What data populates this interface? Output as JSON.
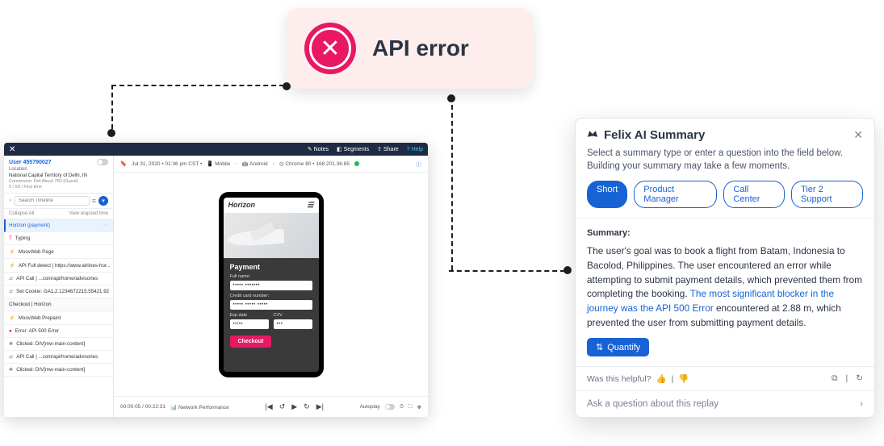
{
  "api_badge": {
    "label": "API error"
  },
  "replay": {
    "topbar": {
      "notes": "Notes",
      "segments": "Segments",
      "share": "Share",
      "help": "Help"
    },
    "user": {
      "id_label": "User 455790027",
      "location_label": "Location",
      "location": "National Capital Territory of Delhi, IN",
      "conv_label": "Conversion: Def About 750 (Guest)",
      "conv_value": "0 / 50 / First time"
    },
    "search": {
      "placeholder": "Search Timeline"
    },
    "collapse": {
      "left": "Collapse All",
      "right": "View elapsed time"
    },
    "timeline_items": [
      {
        "label": "Horizon (payment)",
        "selected": true
      },
      {
        "label": "Typing"
      },
      {
        "label": "MoovWeb Page"
      },
      {
        "label": "API Full detect | https://www.airlines-hor..."
      },
      {
        "label": "API Call | ...com/api/home/advisories"
      },
      {
        "label": "Set Cookie: GA1.2.1234672215.55421.92"
      },
      {
        "label": "Checkout | Horizon",
        "header": true
      },
      {
        "label": "MoovWeb Prepaint"
      },
      {
        "label": "Error: API 500 Error"
      },
      {
        "label": "Clicked: DIV[mw-main-content]"
      },
      {
        "label": "API Call | ...com/api/home/advisories"
      },
      {
        "label": "Clicked: DIV[mw-main-content]"
      }
    ],
    "meta": {
      "date": "Jul 31, 2020 • 01:36 pm CST •",
      "device": "Mobile",
      "os": "Android",
      "browser": "Chrome 80 • 168.201.36.85"
    },
    "phone": {
      "brand": "Horizon",
      "payment_title": "Payment",
      "full_name_label": "Full name:",
      "full_name_value": "•••••  •••••••",
      "card_label": "Credit card number:",
      "card_value": "•••••  •••••  •••••",
      "exp_label": "Exp date",
      "exp_value": "••/••",
      "cvv_label": "CVV",
      "cvv_value": "•••",
      "checkout": "Checkout"
    },
    "player": {
      "time": "00:00:05 / 00:22:31",
      "network": "Network Performance",
      "autoplay": "Autoplay"
    }
  },
  "felix": {
    "title": "Felix AI Summary",
    "instructions": "Select a summary type or enter a question into the field below. Building your summary may take a few moments.",
    "chips": [
      "Short",
      "Product Manager",
      "Call Center",
      "Tier 2 Support"
    ],
    "summary_label": "Summary:",
    "summary_pre": "The user's goal was to book a flight from Batam, Indonesia to Bacolod, Philippines. The user encountered an error while attempting to submit payment details, which prevented them from completing the booking. ",
    "summary_highlight": "The most significant blocker in the journey was the API 500 Error",
    "summary_post": " encountered at 2.88 m, which prevented the user from submitting payment details.",
    "quantify": "Quantify",
    "helpful": "Was this helpful?",
    "ask_placeholder": "Ask a question about this replay"
  }
}
